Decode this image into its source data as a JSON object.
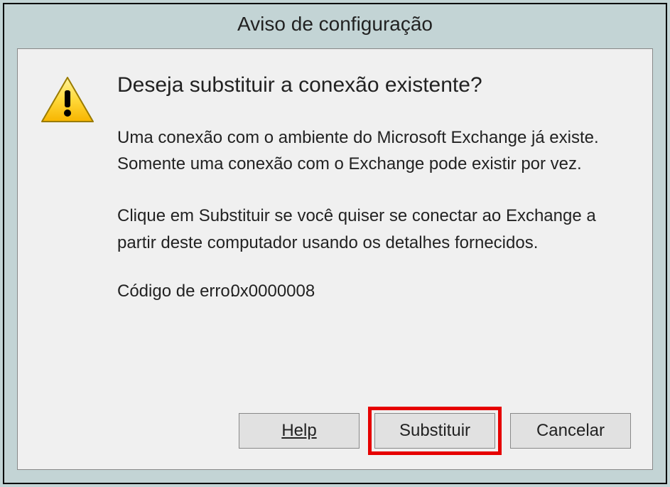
{
  "dialog": {
    "title": "Aviso de configuração",
    "heading": "Deseja substituir a conexão existente?",
    "paragraph1": "Uma conexão com o ambiente do Microsoft Exchange já existe. Somente uma conexão com o Exchange pode existir por vez.",
    "paragraph2": "Clique em Substituir se você quiser se conectar ao Exchange a partir deste computador usando os detalhes fornecidos.",
    "error_label": "Código de erro:",
    "error_code": "0x0000008",
    "buttons": {
      "help": "Help",
      "replace": "Substituir",
      "cancel": "Cancelar"
    }
  }
}
